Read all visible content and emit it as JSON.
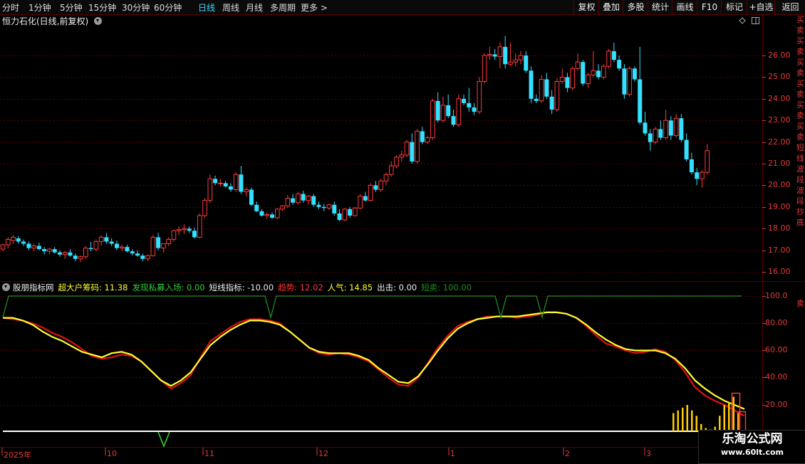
{
  "toolbar": {
    "periods": [
      "分时",
      "1分钟",
      "5分钟",
      "15分钟",
      "30分钟",
      "60分钟",
      "日线",
      "周线",
      "月线",
      "多周期",
      "更多 >"
    ],
    "active_period": "日线",
    "right_buttons": [
      "复权",
      "叠加",
      "多股",
      "统计",
      "画线",
      "F10",
      "标记",
      "+自选",
      "返回"
    ]
  },
  "stock": {
    "title": "恒力石化(日线,前复权)",
    "corner_icons": [
      "diamond-icon",
      "panel-icon"
    ]
  },
  "price_axis": {
    "labels": [
      "26.00",
      "25.00",
      "24.00",
      "23.00",
      "22.00",
      "21.00",
      "20.00",
      "19.00",
      "18.00",
      "17.00",
      "16.00"
    ]
  },
  "side_strip_text": "买卖买卖买卖买卖买卖买卖短线波段波段抄底",
  "indicator": {
    "name": "股朋指标网",
    "items": [
      {
        "label": "超大户筹码: 11.38",
        "color": "#ffff33"
      },
      {
        "label": "发现私募入场: 0.00",
        "color": "#33cc33"
      },
      {
        "label": "短线指标: -10.00",
        "color": "#eeeeee"
      },
      {
        "label": "趋势: 12.02",
        "color": "#ff3333"
      },
      {
        "label": "人气: 14.85",
        "color": "#ffff33"
      },
      {
        "label": "出击: 0.00",
        "color": "#eeeeee"
      },
      {
        "label": "短卖: 100.00",
        "color": "#1f8f1f"
      }
    ],
    "axis_labels": [
      "100.0",
      "80.00",
      "60.00",
      "40.00",
      "20.00"
    ],
    "side_marker": "卖"
  },
  "date_axis": {
    "labels": [
      "2025年",
      "10",
      "11",
      "12",
      "1",
      "2",
      "3"
    ]
  },
  "watermark": {
    "name": "乐淘公式网",
    "url": "www.60lt.com"
  },
  "colors": {
    "up": "#ff3b3b",
    "down": "#33e0ff",
    "grid": "#5a0000",
    "trend_line": "#e01010",
    "popularity_line": "#ffff33",
    "signal_line": "#1f8f1f"
  },
  "chart_data": {
    "type": "candlestick",
    "price_range": [
      15.5,
      27.0
    ],
    "indicator_range": [
      0,
      105
    ],
    "candles": [
      [
        17.05,
        17.3,
        16.95,
        17.25
      ],
      [
        17.25,
        17.6,
        17.1,
        17.5
      ],
      [
        17.45,
        17.7,
        17.3,
        17.6
      ],
      [
        17.55,
        17.65,
        17.3,
        17.4
      ],
      [
        17.4,
        17.5,
        17.2,
        17.3
      ],
      [
        17.3,
        17.4,
        17.0,
        17.1
      ],
      [
        17.1,
        17.3,
        16.95,
        17.2
      ],
      [
        17.2,
        17.35,
        17.0,
        17.05
      ],
      [
        17.05,
        17.15,
        16.8,
        16.95
      ],
      [
        16.95,
        17.1,
        16.8,
        17.05
      ],
      [
        17.05,
        17.15,
        16.85,
        16.9
      ],
      [
        16.9,
        17.0,
        16.7,
        16.8
      ],
      [
        16.8,
        16.95,
        16.6,
        16.9
      ],
      [
        16.9,
        17.05,
        16.7,
        16.75
      ],
      [
        16.75,
        16.85,
        16.5,
        16.6
      ],
      [
        16.6,
        16.75,
        16.45,
        16.7
      ],
      [
        16.7,
        17.2,
        16.6,
        17.1
      ],
      [
        17.1,
        17.4,
        16.95,
        17.05
      ],
      [
        17.05,
        17.5,
        16.95,
        17.4
      ],
      [
        17.4,
        17.7,
        17.2,
        17.6
      ],
      [
        17.6,
        17.8,
        17.3,
        17.4
      ],
      [
        17.4,
        17.55,
        17.2,
        17.3
      ],
      [
        17.3,
        17.45,
        17.0,
        17.1
      ],
      [
        17.1,
        17.25,
        16.95,
        17.15
      ],
      [
        17.15,
        17.25,
        16.9,
        16.95
      ],
      [
        16.95,
        17.05,
        16.75,
        16.85
      ],
      [
        16.85,
        17.0,
        16.7,
        16.75
      ],
      [
        16.75,
        16.85,
        16.5,
        16.6
      ],
      [
        16.6,
        16.8,
        16.5,
        16.75
      ],
      [
        16.75,
        17.7,
        16.7,
        17.6
      ],
      [
        17.6,
        17.8,
        17.0,
        17.1
      ],
      [
        17.1,
        17.3,
        16.9,
        17.3
      ],
      [
        17.3,
        17.6,
        17.2,
        17.5
      ],
      [
        17.5,
        17.95,
        17.4,
        17.9
      ],
      [
        17.9,
        18.1,
        17.7,
        17.95
      ],
      [
        17.95,
        18.2,
        17.75,
        18.0
      ],
      [
        18.0,
        18.1,
        17.8,
        17.9
      ],
      [
        17.9,
        18.05,
        17.55,
        17.6
      ],
      [
        17.6,
        18.7,
        17.55,
        18.6
      ],
      [
        18.6,
        19.4,
        18.5,
        19.3
      ],
      [
        19.3,
        20.5,
        19.2,
        20.3
      ],
      [
        20.3,
        20.45,
        20.0,
        20.1
      ],
      [
        20.1,
        20.3,
        19.95,
        20.1
      ],
      [
        20.1,
        20.2,
        19.9,
        19.95
      ],
      [
        19.95,
        20.1,
        19.7,
        19.8
      ],
      [
        19.8,
        20.6,
        19.7,
        20.5
      ],
      [
        20.5,
        20.9,
        19.6,
        19.7
      ],
      [
        19.7,
        19.9,
        19.5,
        19.8
      ],
      [
        19.8,
        19.9,
        19.05,
        19.1
      ],
      [
        19.1,
        19.25,
        18.75,
        18.8
      ],
      [
        18.8,
        18.9,
        18.55,
        18.6
      ],
      [
        18.6,
        18.75,
        18.45,
        18.65
      ],
      [
        18.65,
        18.75,
        18.45,
        18.5
      ],
      [
        18.5,
        18.95,
        18.45,
        18.9
      ],
      [
        18.9,
        19.1,
        18.8,
        19.05
      ],
      [
        19.05,
        19.55,
        18.95,
        19.4
      ],
      [
        19.4,
        19.6,
        19.1,
        19.2
      ],
      [
        19.2,
        19.7,
        19.1,
        19.6
      ],
      [
        19.6,
        19.75,
        19.2,
        19.3
      ],
      [
        19.3,
        19.55,
        19.1,
        19.5
      ],
      [
        19.5,
        19.6,
        19.0,
        19.1
      ],
      [
        19.1,
        19.25,
        18.9,
        19.0
      ],
      [
        19.0,
        19.15,
        18.8,
        18.95
      ],
      [
        18.95,
        19.15,
        18.85,
        19.1
      ],
      [
        19.1,
        19.25,
        18.6,
        18.7
      ],
      [
        18.7,
        18.9,
        18.35,
        18.4
      ],
      [
        18.4,
        18.95,
        18.35,
        18.9
      ],
      [
        18.9,
        19.0,
        18.5,
        18.6
      ],
      [
        18.6,
        19.0,
        18.55,
        18.95
      ],
      [
        18.95,
        19.6,
        18.9,
        19.5
      ],
      [
        19.5,
        19.7,
        19.25,
        19.3
      ],
      [
        19.3,
        20.1,
        19.25,
        20.0
      ],
      [
        20.0,
        20.2,
        19.7,
        19.8
      ],
      [
        19.8,
        20.3,
        19.7,
        20.2
      ],
      [
        20.2,
        20.6,
        20.0,
        20.5
      ],
      [
        20.5,
        21.1,
        20.4,
        20.9
      ],
      [
        20.9,
        21.4,
        20.8,
        21.3
      ],
      [
        21.3,
        21.6,
        21.1,
        21.4
      ],
      [
        21.4,
        22.1,
        21.3,
        22.0
      ],
      [
        22.0,
        22.4,
        21.0,
        21.1
      ],
      [
        21.1,
        22.6,
        21.0,
        22.5
      ],
      [
        22.5,
        22.7,
        21.9,
        22.0
      ],
      [
        22.0,
        22.3,
        21.9,
        22.2
      ],
      [
        22.2,
        24.0,
        22.1,
        23.9
      ],
      [
        23.9,
        24.3,
        22.9,
        23.0
      ],
      [
        23.0,
        24.1,
        22.9,
        23.7
      ],
      [
        23.7,
        24.2,
        23.1,
        23.2
      ],
      [
        23.2,
        23.5,
        22.7,
        22.8
      ],
      [
        22.8,
        24.2,
        22.7,
        24.0
      ],
      [
        24.0,
        24.2,
        23.7,
        23.8
      ],
      [
        23.8,
        24.5,
        23.4,
        23.6
      ],
      [
        23.6,
        23.8,
        23.25,
        23.4
      ],
      [
        23.4,
        25.0,
        23.3,
        24.8
      ],
      [
        24.8,
        26.1,
        24.7,
        26.0
      ],
      [
        26.0,
        26.4,
        25.8,
        26.05
      ],
      [
        26.05,
        26.3,
        25.8,
        25.95
      ],
      [
        25.95,
        26.6,
        25.4,
        26.4
      ],
      [
        26.4,
        26.9,
        25.4,
        25.6
      ],
      [
        25.6,
        26.6,
        25.5,
        25.7
      ],
      [
        25.7,
        26.1,
        25.5,
        25.8
      ],
      [
        25.8,
        26.2,
        25.6,
        26.0
      ],
      [
        26.0,
        26.2,
        25.2,
        25.3
      ],
      [
        25.3,
        25.5,
        23.8,
        24.0
      ],
      [
        24.0,
        24.2,
        23.8,
        23.9
      ],
      [
        23.9,
        25.1,
        23.8,
        24.9
      ],
      [
        24.9,
        25.2,
        24.0,
        24.1
      ],
      [
        24.1,
        24.4,
        23.3,
        23.5
      ],
      [
        23.5,
        24.95,
        23.4,
        24.8
      ],
      [
        24.8,
        25.4,
        24.7,
        25.0
      ],
      [
        25.0,
        25.2,
        24.3,
        24.5
      ],
      [
        24.5,
        25.5,
        24.4,
        25.4
      ],
      [
        25.4,
        26.1,
        25.3,
        25.7
      ],
      [
        25.7,
        25.8,
        24.6,
        24.7
      ],
      [
        24.7,
        25.2,
        24.5,
        25.1
      ],
      [
        25.1,
        26.2,
        25.0,
        25.3
      ],
      [
        25.3,
        25.6,
        24.9,
        25.0
      ],
      [
        25.0,
        25.6,
        24.9,
        25.5
      ],
      [
        25.5,
        26.3,
        25.4,
        26.2
      ],
      [
        26.2,
        26.6,
        25.7,
        25.8
      ],
      [
        25.8,
        26.0,
        25.3,
        25.4
      ],
      [
        25.4,
        25.6,
        24.0,
        24.2
      ],
      [
        24.2,
        25.5,
        24.1,
        25.4
      ],
      [
        25.4,
        25.5,
        24.8,
        24.9
      ],
      [
        24.9,
        26.4,
        22.8,
        22.9
      ],
      [
        22.9,
        23.4,
        22.3,
        22.4
      ],
      [
        22.4,
        22.6,
        21.6,
        22.0
      ],
      [
        22.0,
        22.7,
        21.9,
        22.6
      ],
      [
        22.6,
        23.0,
        22.1,
        22.2
      ],
      [
        22.2,
        23.5,
        22.1,
        23.0
      ],
      [
        23.0,
        23.2,
        22.1,
        22.3
      ],
      [
        22.3,
        23.3,
        22.2,
        23.1
      ],
      [
        23.1,
        23.3,
        22.0,
        22.1
      ],
      [
        22.1,
        22.4,
        21.1,
        21.2
      ],
      [
        21.2,
        21.5,
        20.5,
        20.6
      ],
      [
        20.6,
        20.8,
        20.0,
        20.3
      ],
      [
        20.3,
        20.7,
        19.9,
        20.6
      ],
      [
        20.6,
        21.9,
        20.5,
        21.6
      ]
    ],
    "trend": [
      84,
      83,
      82,
      80,
      77,
      73,
      70,
      66,
      61,
      56,
      54,
      55,
      57,
      56,
      52,
      45,
      38,
      32,
      36,
      42,
      55,
      67,
      72,
      77,
      81,
      83,
      83,
      82,
      80,
      74,
      68,
      62,
      58,
      57,
      58,
      57,
      55,
      52,
      46,
      40,
      35,
      34,
      40,
      51,
      62,
      71,
      78,
      81,
      83,
      85,
      85,
      85,
      84,
      85,
      86,
      88,
      88,
      87,
      84,
      78,
      71,
      65,
      63,
      60,
      58,
      59,
      61,
      59,
      53,
      44,
      33,
      27,
      23,
      20,
      16,
      12
    ],
    "popularity": [
      84,
      84,
      82,
      79,
      74,
      70,
      67,
      63,
      59,
      57,
      55,
      58,
      59,
      57,
      52,
      45,
      38,
      34,
      38,
      44,
      54,
      64,
      70,
      75,
      79,
      82,
      82,
      81,
      79,
      74,
      68,
      62,
      59,
      58,
      58,
      58,
      56,
      53,
      47,
      42,
      37,
      36,
      41,
      50,
      60,
      69,
      76,
      80,
      83,
      84,
      85,
      85,
      85,
      86,
      87,
      88,
      88,
      87,
      84,
      79,
      73,
      68,
      64,
      61,
      60,
      60,
      60,
      58,
      54,
      47,
      38,
      32,
      27,
      23,
      20,
      17
    ],
    "short_sell_signal_x_indices": [
      0,
      28,
      48,
      53
    ],
    "yellow_volume_bars": [
      14,
      16,
      18,
      20,
      16,
      12,
      6,
      3,
      2,
      4,
      12,
      20,
      22,
      26,
      14
    ]
  }
}
